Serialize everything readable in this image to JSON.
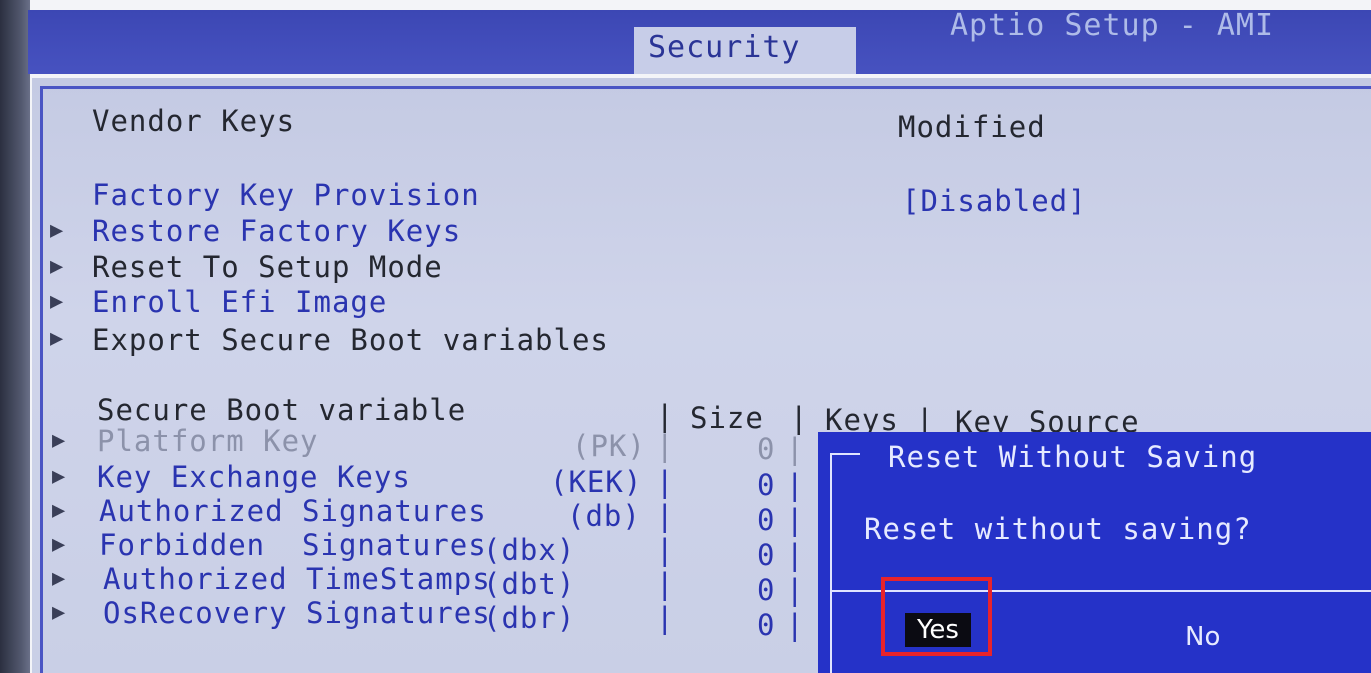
{
  "header": {
    "title": "Aptio Setup - AMI",
    "active_tab": "Security"
  },
  "vendor_keys": {
    "label": "Vendor Keys",
    "value": "Modified"
  },
  "factory_key_provision": {
    "label": "Factory Key Provision",
    "value": "[Disabled]"
  },
  "menu_items": [
    {
      "label": "Restore Factory Keys"
    },
    {
      "label": "Reset To Setup Mode"
    },
    {
      "label": "Enroll Efi Image"
    },
    {
      "label": "Export Secure Boot variables"
    }
  ],
  "variables_table": {
    "header": {
      "variable": "Secure Boot variable",
      "size": "Size",
      "keys": "Keys",
      "key_source": "Key Source"
    },
    "rows": [
      {
        "name": "Platform Key",
        "abbr": "(PK)",
        "size": "0"
      },
      {
        "name": "Key Exchange Keys",
        "abbr": "(KEK)",
        "size": "0"
      },
      {
        "name": "Authorized Signatures",
        "abbr": "(db)",
        "size": "0"
      },
      {
        "name": "Forbidden  Signatures",
        "abbr": "(dbx)",
        "size": "0"
      },
      {
        "name": "Authorized TimeStamps",
        "abbr": "(dbt)",
        "size": "0"
      },
      {
        "name": "OsRecovery Signatures",
        "abbr": "(dbr)",
        "size": "0"
      }
    ]
  },
  "dialog": {
    "title": "Reset Without Saving",
    "message": "Reset without saving?",
    "yes_label": "Yes",
    "no_label": "No"
  }
}
